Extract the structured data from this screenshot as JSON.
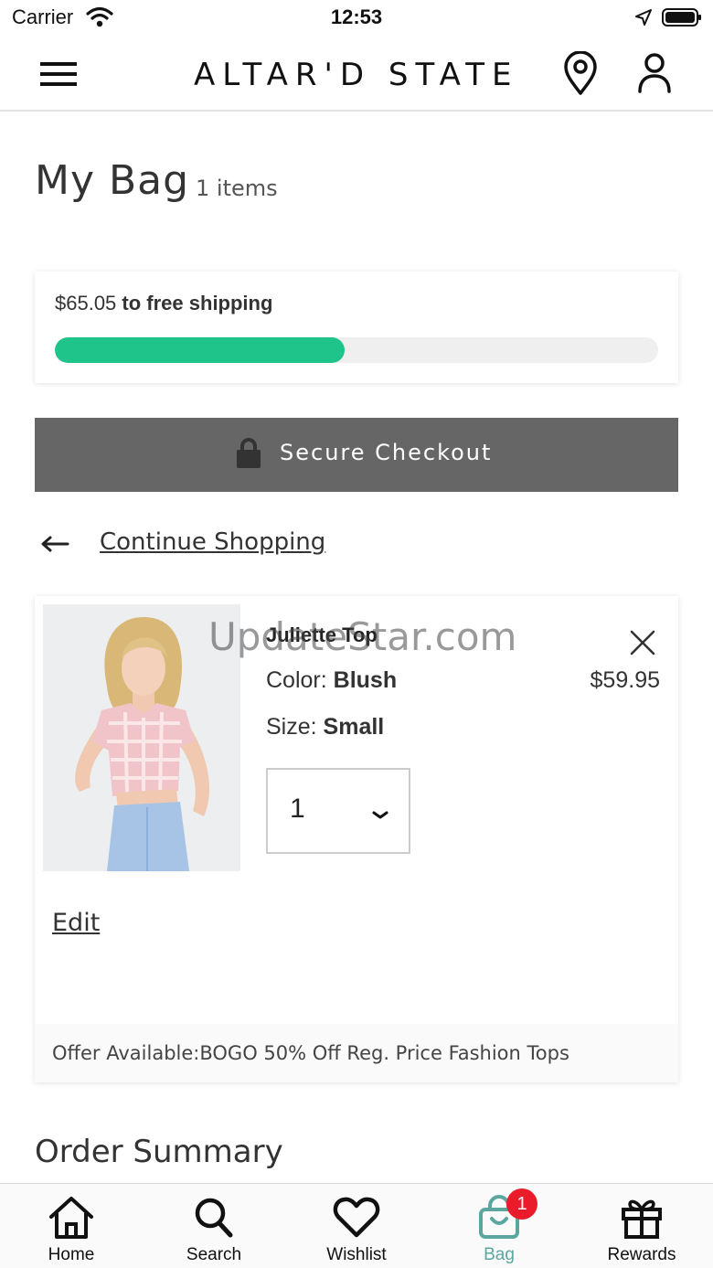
{
  "status_bar": {
    "carrier": "Carrier",
    "time": "12:53"
  },
  "header": {
    "logo_text": "ALTAR'D STATE",
    "menu_icon": "hamburger-menu-icon",
    "location_icon": "map-pin-icon",
    "account_icon": "person-icon"
  },
  "page": {
    "title": "My Bag",
    "item_count": "1 items"
  },
  "shipping": {
    "amount": "$65.05",
    "text": "to free shipping",
    "progress_fraction": 0.48,
    "progress_color": "#1fc48a"
  },
  "checkout": {
    "label": "Secure Checkout",
    "button_color": "#666666"
  },
  "continue_shopping": {
    "label": "Continue Shopping"
  },
  "cart_items": [
    {
      "name": "Juliette Top",
      "color_label": "Color:",
      "color_value": "Blush",
      "size_label": "Size:",
      "size_value": "Small",
      "price": "$59.95",
      "quantity": "1",
      "edit_label": "Edit",
      "offer": "Offer Available:BOGO 50% Off Reg. Price Fashion Tops"
    }
  ],
  "watermark": "UpdateStar.com",
  "order_summary": {
    "title": "Order Summary"
  },
  "tab_bar": {
    "active_color": "#5ba7a0",
    "badge_color": "#ea1c2b",
    "tabs": [
      {
        "label": "Home",
        "icon": "home-icon"
      },
      {
        "label": "Search",
        "icon": "magnifier-icon"
      },
      {
        "label": "Wishlist",
        "icon": "heart-icon"
      },
      {
        "label": "Bag",
        "icon": "shopping-bag-icon",
        "badge": "1",
        "active": true
      },
      {
        "label": "Rewards",
        "icon": "gift-icon"
      }
    ]
  }
}
